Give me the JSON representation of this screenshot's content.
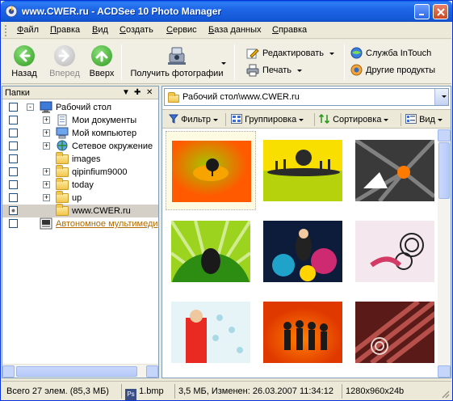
{
  "window": {
    "title": "www.CWER.ru - ACDSee 10 Photo Manager"
  },
  "menu": [
    "Файл",
    "Правка",
    "Вид",
    "Создать",
    "Сервис",
    "База данных",
    "Справка"
  ],
  "toolbar": {
    "back": "Назад",
    "forward": "Вперед",
    "up": "Вверх",
    "get_photos": "Получить фотографии",
    "edit": "Редактировать",
    "print": "Печать",
    "intouch": "Служба InTouch",
    "other_products": "Другие продукты"
  },
  "left_panel": {
    "header": "Папки",
    "tree": [
      {
        "label": "Рабочий стол",
        "level": 0,
        "expander": "-",
        "icon": "desktop-icon",
        "selected": false,
        "checked": false
      },
      {
        "label": "Мои документы",
        "level": 1,
        "expander": "+",
        "icon": "documents-icon",
        "selected": false,
        "checked": false
      },
      {
        "label": "Мой компьютер",
        "level": 1,
        "expander": "+",
        "icon": "computer-icon",
        "selected": false,
        "checked": false
      },
      {
        "label": "Сетевое окружение",
        "level": 1,
        "expander": "+",
        "icon": "network-icon",
        "selected": false,
        "checked": false
      },
      {
        "label": "images",
        "level": 1,
        "expander": "",
        "icon": "folder-icon",
        "selected": false,
        "checked": false
      },
      {
        "label": "qipinfium9000",
        "level": 1,
        "expander": "+",
        "icon": "folder-icon",
        "selected": false,
        "checked": false
      },
      {
        "label": "today",
        "level": 1,
        "expander": "+",
        "icon": "folder-icon",
        "selected": false,
        "checked": false
      },
      {
        "label": "up",
        "level": 1,
        "expander": "+",
        "icon": "folder-icon",
        "selected": false,
        "checked": false
      },
      {
        "label": "www.CWER.ru",
        "level": 1,
        "expander": "",
        "icon": "folder-icon",
        "selected": true,
        "checked": true
      },
      {
        "label": "Автономное мультимеди",
        "level": 0,
        "expander": "",
        "icon": "media-icon",
        "selected": false,
        "checked": false,
        "link": true
      }
    ]
  },
  "right_panel": {
    "path": "Рабочий стол\\www.CWER.ru",
    "filter": "Фильтр",
    "group": "Группировка",
    "sort": "Сортировка",
    "view": "Вид"
  },
  "thumbnails": [
    {
      "name": "thumb-1",
      "palette": [
        "#f7a300",
        "#ff5a00",
        "#a4c600"
      ],
      "selected": true
    },
    {
      "name": "thumb-2",
      "palette": [
        "#b5d20c",
        "#f9df00",
        "#2a2a2a"
      ],
      "selected": false
    },
    {
      "name": "thumb-3",
      "palette": [
        "#3a3a3a",
        "#b0b0b0",
        "#ff7a00"
      ],
      "selected": false
    },
    {
      "name": "thumb-4",
      "palette": [
        "#9bd31f",
        "#2d8c12",
        "#1a1a1a"
      ],
      "selected": false
    },
    {
      "name": "thumb-5",
      "palette": [
        "#0c1c3a",
        "#ff2e80",
        "#26c6f0"
      ],
      "selected": false
    },
    {
      "name": "thumb-6",
      "palette": [
        "#f4e8ee",
        "#d33a66",
        "#222222"
      ],
      "selected": false
    },
    {
      "name": "thumb-7",
      "palette": [
        "#e6f4f8",
        "#e82a22",
        "#6fc0d6"
      ],
      "selected": false
    },
    {
      "name": "thumb-8",
      "palette": [
        "#e03900",
        "#ff8000",
        "#1a1a1a"
      ],
      "selected": false
    },
    {
      "name": "thumb-9",
      "palette": [
        "#5a1b18",
        "#b7504a",
        "#e8d4d0"
      ],
      "selected": false
    }
  ],
  "status": {
    "count": "Всего 27 элем. (85,3 МБ)",
    "file": "1.bmp",
    "info": "3,5 МБ, Изменен: 26.03.2007 11:34:12",
    "dims": "1280x960x24b"
  }
}
